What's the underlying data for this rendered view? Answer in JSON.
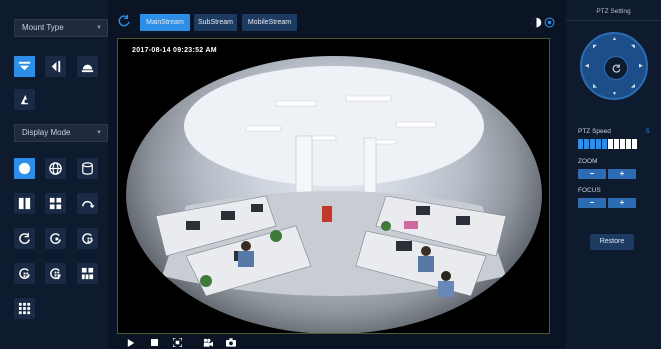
{
  "left": {
    "mount_type": "Mount Type",
    "display_mode": "Display Mode"
  },
  "top_tabs": [
    "MainStream",
    "SubStream",
    "MobileStream"
  ],
  "video": {
    "timestamp": "2017-08-14 09:23:52 AM"
  },
  "ptz": {
    "title": "PTZ Setting",
    "speed_label": "PTZ Speed",
    "speed_value": "5",
    "speed_level": 5,
    "speed_segments": 10,
    "zoom_label": "ZOOM",
    "focus_label": "FOCUS",
    "minus": "−",
    "plus": "+",
    "restore": "Restore"
  },
  "colors": {
    "accent": "#2d8ee8",
    "panel": "#0e1a2d",
    "background": "#0b1424"
  }
}
